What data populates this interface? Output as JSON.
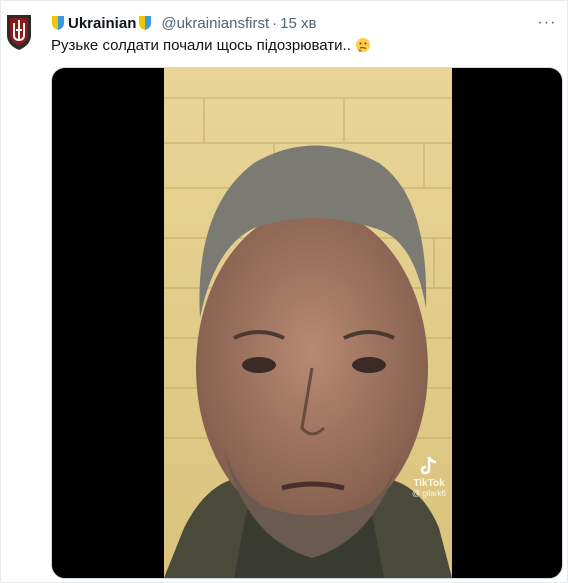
{
  "tweet": {
    "display_name": "Ukrainian",
    "handle": "@ukrainiansfirst",
    "separator": "·",
    "time": "15 хв",
    "text": "Рузьке солдати почали щось підозрювати..",
    "more_label": "···"
  },
  "media": {
    "watermark_brand": "TikTok",
    "watermark_user": "@ gilark6"
  },
  "colors": {
    "wall": "#e3cf8d",
    "video_bg": "#000000",
    "badge_yellow": "#f2c500",
    "badge_blue": "#3b9ae1"
  }
}
